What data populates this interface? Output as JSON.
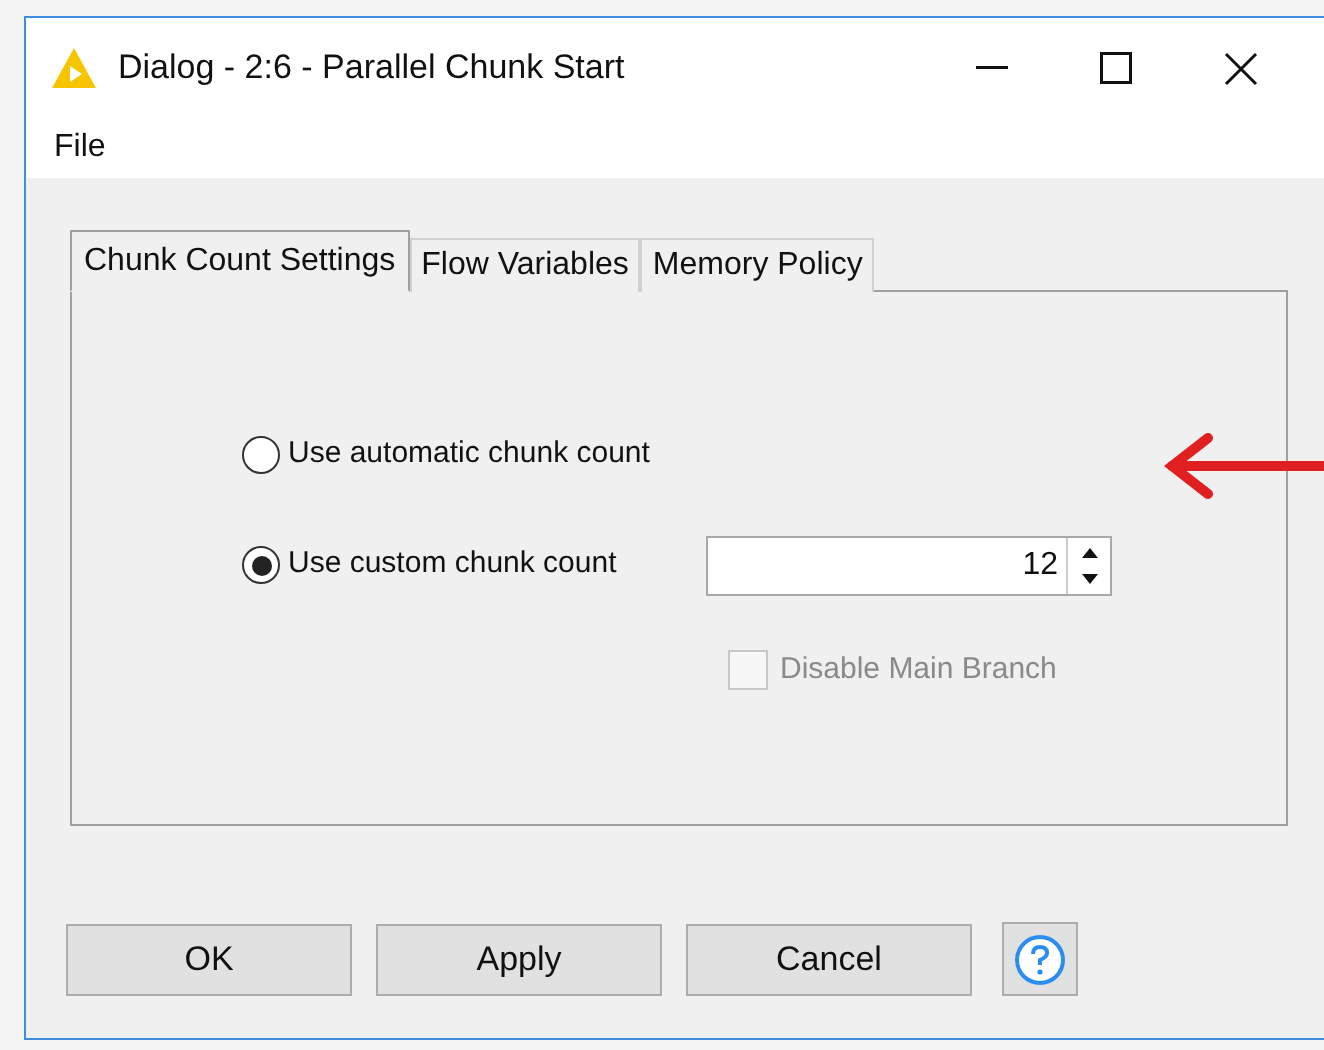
{
  "window": {
    "title": "Dialog - 2:6 - Parallel Chunk Start"
  },
  "menu": [
    "File"
  ],
  "tabs": [
    {
      "label": "Chunk Count Settings",
      "selected": true
    },
    {
      "label": "Flow Variables",
      "selected": false
    },
    {
      "label": "Memory Policy",
      "selected": false
    }
  ],
  "options": [
    {
      "label": "Use automatic chunk count",
      "selected": false
    },
    {
      "label": "Use custom chunk count",
      "selected": true
    }
  ],
  "chunk_count": {
    "value": "12"
  },
  "disable_main_branch": {
    "label": "Disable Main Branch",
    "checked": false,
    "disabled": true
  },
  "buttons": [
    "OK",
    "Apply",
    "Cancel"
  ]
}
